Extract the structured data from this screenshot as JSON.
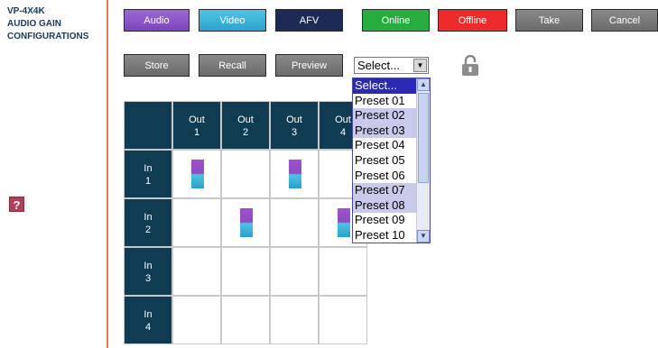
{
  "nav": {
    "items": [
      "VP-4X4K",
      "AUDIO GAIN",
      "CONFIGURATIONS"
    ],
    "help_label": "?"
  },
  "toolbar": {
    "audio": "Audio",
    "video": "Video",
    "afv": "AFV",
    "online": "Online",
    "offline": "Offline",
    "take": "Take",
    "cancel": "Cancel",
    "store": "Store",
    "recall": "Recall",
    "preview": "Preview"
  },
  "preset_select": {
    "value": "Select...",
    "options": [
      "Select...",
      "Preset 01",
      "Preset 02",
      "Preset 03",
      "Preset 04",
      "Preset 05",
      "Preset 06",
      "Preset 07",
      "Preset 08",
      "Preset 09",
      "Preset 10"
    ]
  },
  "matrix": {
    "outputs": [
      {
        "label": "Out",
        "num": "1"
      },
      {
        "label": "Out",
        "num": "2"
      },
      {
        "label": "Out",
        "num": "3"
      },
      {
        "label": "Out",
        "num": "4"
      }
    ],
    "inputs": [
      {
        "label": "In",
        "num": "1"
      },
      {
        "label": "In",
        "num": "2"
      },
      {
        "label": "In",
        "num": "3"
      },
      {
        "label": "In",
        "num": "4"
      }
    ]
  },
  "colors": {
    "audio": "#9c69d6",
    "video": "#2aa4cf",
    "afv": "#1c2b55",
    "online": "#27ad3e",
    "offline": "#ef2a2a",
    "header": "#0f3c52",
    "divider": "#e2795a"
  },
  "icons": {
    "lock": "unlocked-padlock-icon",
    "help": "help-icon"
  }
}
